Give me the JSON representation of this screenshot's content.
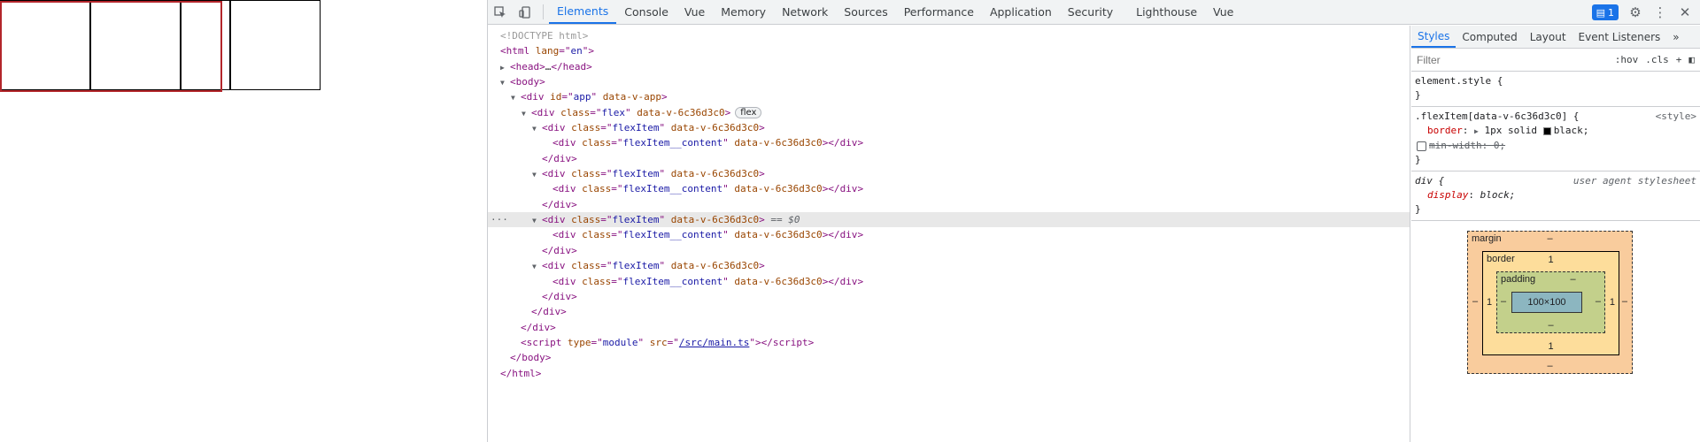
{
  "toolbar": {
    "tabs": [
      "Elements",
      "Console",
      "Vue",
      "Memory",
      "Network",
      "Sources",
      "Performance",
      "Application",
      "Security",
      "Lighthouse",
      "Vue"
    ],
    "issues_count": "1"
  },
  "elements": {
    "doctype": "<!DOCTYPE html>",
    "html_tag": "html",
    "lang_attr": "lang",
    "lang_val": "en",
    "head_tag": "head",
    "head_ellipsis": "…",
    "body_tag": "body",
    "div_tag": "div",
    "id_attr": "id",
    "app_val": "app",
    "data_v_app": "data-v-app",
    "class_attr": "class",
    "flex_val": "flex",
    "scope_attr": "data-v-6c36d3c0",
    "flex_badge": "flex",
    "item_val": "flexItem",
    "content_val": "flexItem__content",
    "selected_marker": "== $0",
    "dots": "···",
    "script_tag": "script",
    "type_attr": "type",
    "type_val": "module",
    "src_attr": "src",
    "src_val": "/src/main.ts"
  },
  "sidebar": {
    "tabs": [
      "Styles",
      "Computed",
      "Layout",
      "Event Listeners"
    ],
    "filter_placeholder": "Filter",
    "hov": ":hov",
    "cls": ".cls",
    "rule_element_style": "element.style {",
    "rule_flexitem_selector": ".flexItem[data-v-6c36d3c0] {",
    "rule_flexitem_source": "<style>",
    "prop_border_name": "border",
    "prop_border_value": "1px solid",
    "prop_border_color": "black;",
    "prop_minwidth": "min-width: 0;",
    "rule_div_selector": "div {",
    "rule_div_source": "user agent stylesheet",
    "prop_display_name": "display",
    "prop_display_value": "block;",
    "close_brace": "}"
  },
  "boxmodel": {
    "margin_label": "margin",
    "margin_top": "–",
    "margin_bottom": "–",
    "margin_left": "–",
    "margin_right": "–",
    "border_label": "border",
    "border_top": "1",
    "border_bottom": "1",
    "border_left": "1",
    "border_right": "1",
    "padding_label": "padding",
    "padding_top": "–",
    "padding_bottom": "–",
    "padding_left": "–",
    "padding_right": "–",
    "content": "100×100"
  },
  "colors": {
    "accent": "#1a73e8",
    "highlight": "#b3262b",
    "margin": "#f9cc9d",
    "border": "#fddd9b",
    "padding": "#c3d08b",
    "content": "#8cb6c0"
  }
}
